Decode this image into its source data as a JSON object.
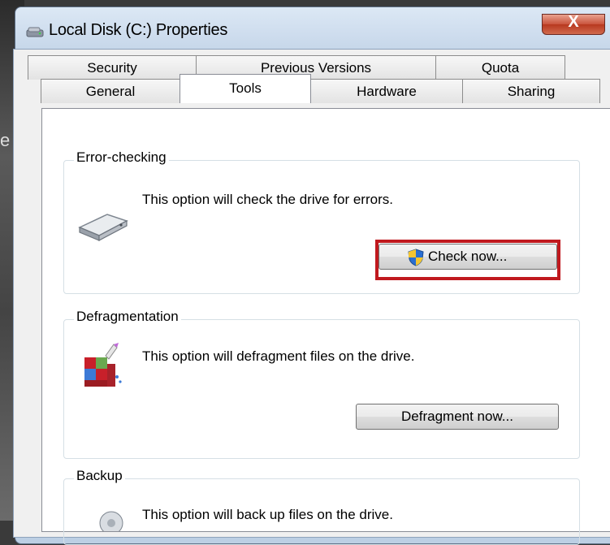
{
  "window": {
    "title": "Local Disk (C:) Properties",
    "close_glyph": "X"
  },
  "tabs": {
    "row1": [
      "Security",
      "Previous Versions",
      "Quota"
    ],
    "row2": [
      "General",
      "Tools",
      "Hardware",
      "Sharing"
    ],
    "active": "Tools"
  },
  "error_checking": {
    "label": "Error-checking",
    "description": "This option will check the drive for errors.",
    "button": "Check now...",
    "icon": "drive-icon"
  },
  "defragmentation": {
    "label": "Defragmentation",
    "description": "This option will defragment files on the drive.",
    "button": "Defragment now...",
    "icon": "defrag-icon"
  },
  "backup": {
    "label": "Backup",
    "description": "This option will back up files on the drive.",
    "icon": "backup-icon"
  },
  "colors": {
    "highlight": "#c0191e",
    "close_button": "#c9523b"
  },
  "desktop_fragments": [
    "e"
  ]
}
